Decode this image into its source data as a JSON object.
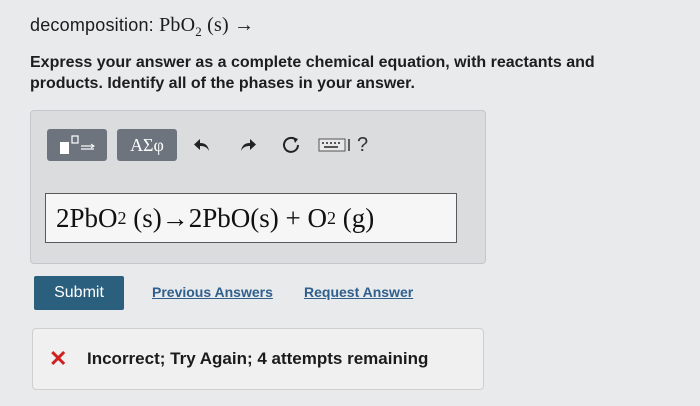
{
  "question": {
    "label": "decomposition: ",
    "reactant": "PbO",
    "reactant_sub": "2",
    "phase": " (s) →"
  },
  "instructions": "Express your answer as a complete chemical equation, with reactants and products. Identify all of the phases in your answer.",
  "toolbar": {
    "greek_label": "ΑΣφ",
    "help_label": "?",
    "icons": [
      "template-icon",
      "undo-icon",
      "redo-icon",
      "reset-icon",
      "keyboard-icon",
      "help-icon"
    ]
  },
  "answer": {
    "part1": "2PbO",
    "sub1": "2",
    "part2": " (s)→2PbO(s) + O",
    "sub2": "2",
    "part3": " (g)"
  },
  "actions": {
    "submit": "Submit",
    "previous_answers": "Previous Answers",
    "request_answer": "Request Answer"
  },
  "feedback": {
    "icon": "x-icon",
    "text": "Incorrect; Try Again; 4 attempts remaining",
    "color": "#cf2020"
  }
}
